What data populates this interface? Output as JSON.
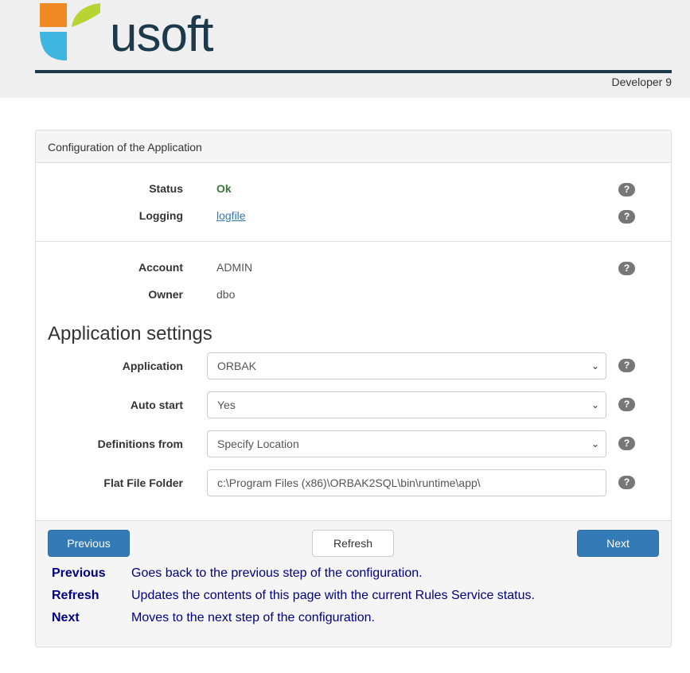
{
  "header": {
    "logo_text": "usoft",
    "version": "Developer 9"
  },
  "panel": {
    "title": "Configuration of the Application"
  },
  "status": {
    "status_label": "Status",
    "status_value": "Ok",
    "logging_label": "Logging",
    "logging_value": "logfile"
  },
  "account": {
    "account_label": "Account",
    "account_value": "ADMIN",
    "owner_label": "Owner",
    "owner_value": "dbo"
  },
  "settings": {
    "title": "Application settings",
    "application_label": "Application",
    "application_value": "ORBAK",
    "auto_start_label": "Auto start",
    "auto_start_value": "Yes",
    "definitions_label": "Definitions from",
    "definitions_value": "Specify Location",
    "flat_file_label": "Flat File Folder",
    "flat_file_value": "c:\\Program Files (x86)\\ORBAK2SQL\\bin\\runtime\\app\\"
  },
  "help_icon_glyph": "?",
  "buttons": {
    "previous": "Previous",
    "refresh": "Refresh",
    "next": "Next"
  },
  "help": [
    {
      "term": "Previous",
      "desc": "Goes back to the previous step of the configuration."
    },
    {
      "term": "Refresh",
      "desc": "Updates the contents of this page with the current Rules Service status."
    },
    {
      "term": "Next",
      "desc": "Moves to the next step of the configuration."
    }
  ],
  "colors": {
    "primary": "#337ab7",
    "logo_dark": "#1c3a4c",
    "logo_orange": "#f08a24",
    "logo_green": "#b7d433",
    "logo_blue": "#3fb6e0",
    "ok_green": "#3c763d",
    "help_text": "#000080"
  }
}
